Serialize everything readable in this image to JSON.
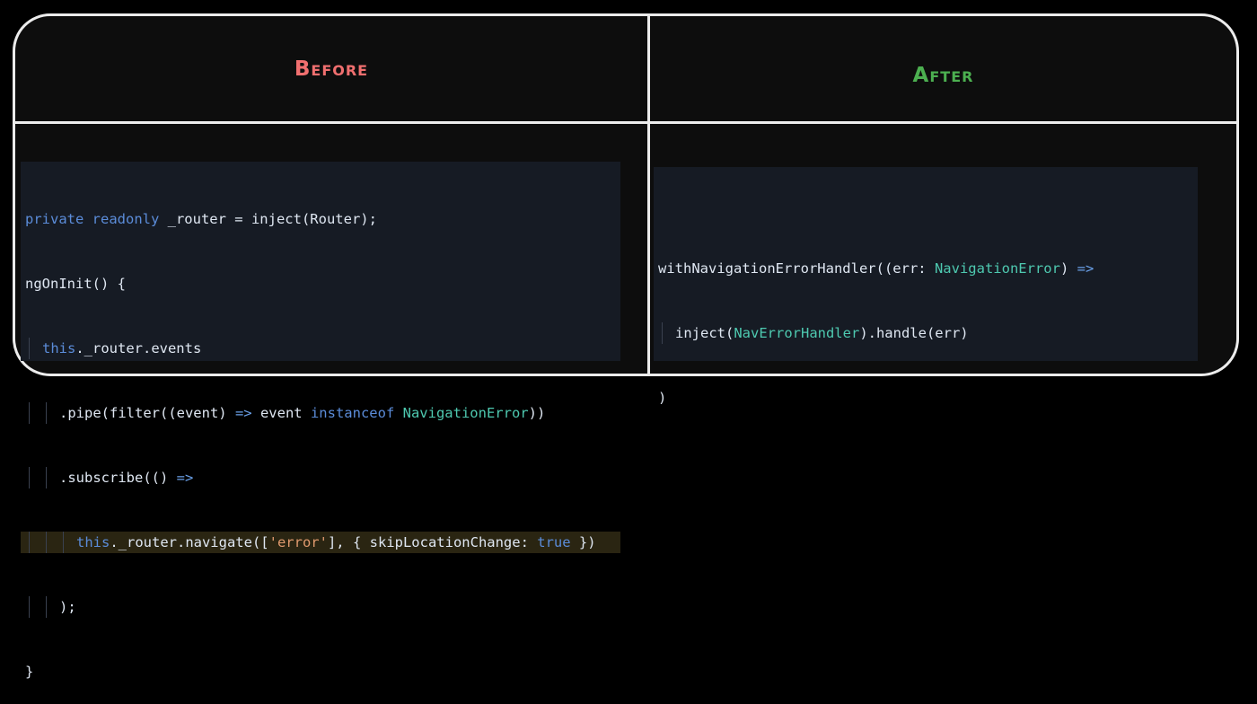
{
  "headings": {
    "before": "Before",
    "after": "After"
  },
  "before_code": {
    "line1": {
      "kw": "private readonly",
      "rest": " _router = inject(Router);"
    },
    "line2": {
      "text": "ngOnInit() {"
    },
    "line3": {
      "kw": "this",
      "rest": "._router.events"
    },
    "line4": {
      "a": ".pipe(filter((event) ",
      "op": "=>",
      "b": " event ",
      "kw": "instanceof",
      "ty": " NavigationError",
      "c": "))"
    },
    "line5": {
      "a": ".subscribe(() ",
      "op": "=>"
    },
    "line6": {
      "kw": "this",
      "a": "._router.navigate([",
      "str": "'error'",
      "b": "], { skipLocationChange: ",
      "bool": "true",
      "c": " })"
    },
    "line7": {
      "text": ");"
    },
    "line8": {
      "text": "}"
    }
  },
  "after_code": {
    "line1": {
      "a": "withNavigationErrorHandler((err: ",
      "ty": "NavigationError",
      "b": ") ",
      "op": "=>"
    },
    "line2": {
      "a": "inject(",
      "ty": "NavErrorHandler",
      "b": ").handle(err)"
    },
    "line3": {
      "text": ")"
    }
  },
  "colors": {
    "before_heading": "#f06f6f",
    "after_heading": "#4caf50",
    "frame_border": "#ececec",
    "code_background": "#161b24"
  }
}
